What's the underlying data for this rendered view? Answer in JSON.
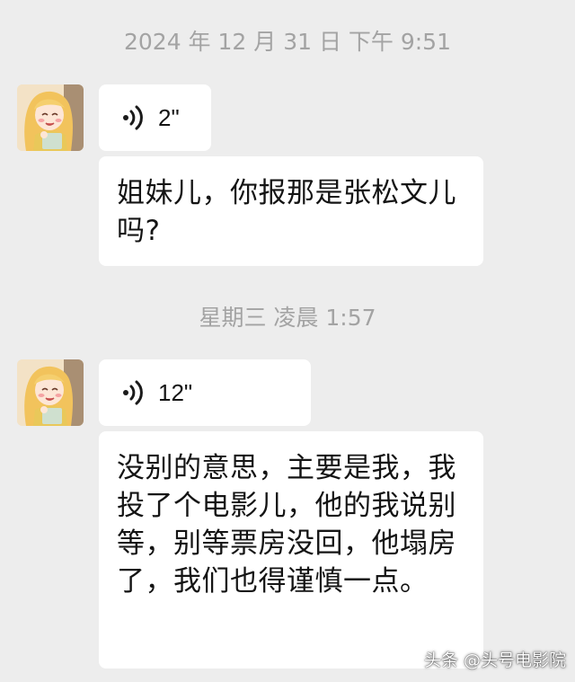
{
  "messages": {
    "ts1": "2024 年 12 月 31 日 下午 9:51",
    "voice1": "2\"",
    "text1": "姐妹儿，你报那是张松文儿吗?",
    "ts2": "星期三 凌晨 1:57",
    "voice2": "12\"",
    "text2": "没别的意思，主要是我，我投了个电影儿，他的我说别等，别等票房没回，他塌房了，我们也得谨慎一点。"
  },
  "watermark": "头条 @头号电影院",
  "colors": {
    "background": "#ededed",
    "bubble": "#ffffff",
    "timestamp": "#a3a3a3"
  },
  "icons": {
    "avatar": "cartoon-blonde-girl-avatar",
    "voice": "voice-wave-icon"
  }
}
